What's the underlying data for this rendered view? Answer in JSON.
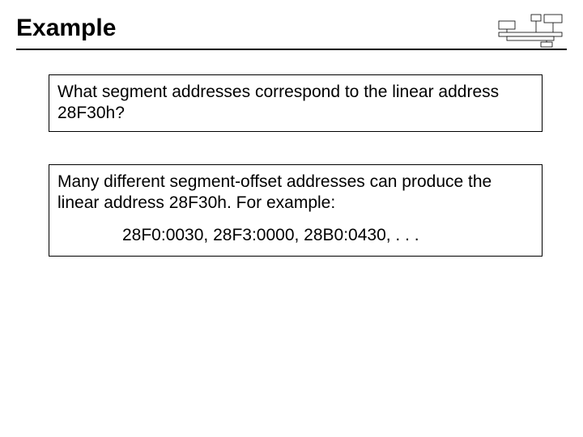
{
  "header": {
    "title": "Example"
  },
  "box1": {
    "text": "What segment addresses correspond to the linear address 28F30h?"
  },
  "box2": {
    "intro": "Many different segment-offset addresses can produce the linear address 28F30h. For example:",
    "addresses": "28F0:0030, 28F3:0000, 28B0:0430, . . ."
  }
}
